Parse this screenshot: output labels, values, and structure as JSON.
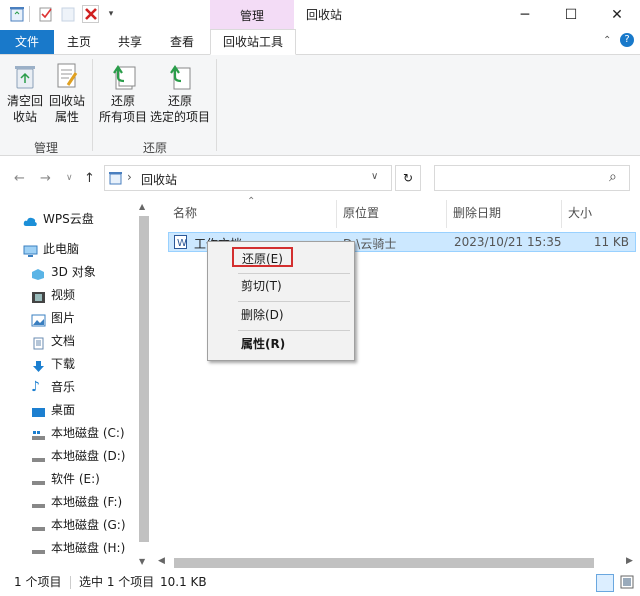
{
  "window": {
    "title": "回收站",
    "context_tab": "管理",
    "buttons": {
      "minimize": "─",
      "maximize": "☐",
      "close": "✕"
    }
  },
  "ribbon_tabs": {
    "file": "文件",
    "home": "主页",
    "share": "共享",
    "view": "查看",
    "tools": "回收站工具"
  },
  "ribbon": {
    "manage_group": {
      "label": "管理",
      "empty_line1": "清空回",
      "empty_line2": "收站",
      "props_line1": "回收站",
      "props_line2": "属性"
    },
    "restore_group": {
      "label": "还原",
      "all_line1": "还原",
      "all_line2": "所有项目",
      "sel_line1": "还原",
      "sel_line2": "选定的项目"
    }
  },
  "address": {
    "separator": "›",
    "location": "回收站",
    "refresh": "↻",
    "search_icon": "⌕"
  },
  "nav": {
    "wps": "WPS云盘",
    "this_pc": "此电脑",
    "items": [
      "3D 对象",
      "视频",
      "图片",
      "文档",
      "下载",
      "音乐",
      "桌面",
      "本地磁盘 (C:)",
      "本地磁盘 (D:)",
      "软件 (E:)",
      "本地磁盘 (F:)",
      "本地磁盘 (G:)",
      "本地磁盘 (H:)"
    ]
  },
  "columns": {
    "name": "名称",
    "location": "原位置",
    "deleted": "删除日期",
    "size": "大小"
  },
  "files": [
    {
      "name": "工作文档",
      "location": "D:\\云骑士",
      "deleted": "2023/10/21 15:35",
      "size": "11 KB"
    }
  ],
  "context_menu": {
    "restore": "还原(E)",
    "cut": "剪切(T)",
    "delete": "删除(D)",
    "properties": "属性(R)"
  },
  "status": {
    "count": "1 个项目",
    "selected": "选中 1 个项目",
    "size": "10.1 KB"
  },
  "colors": {
    "accent": "#1979ca",
    "context_tab": "#f3dcf6",
    "selection": "#cce8ff",
    "highlight_box": "#d32f2f"
  }
}
